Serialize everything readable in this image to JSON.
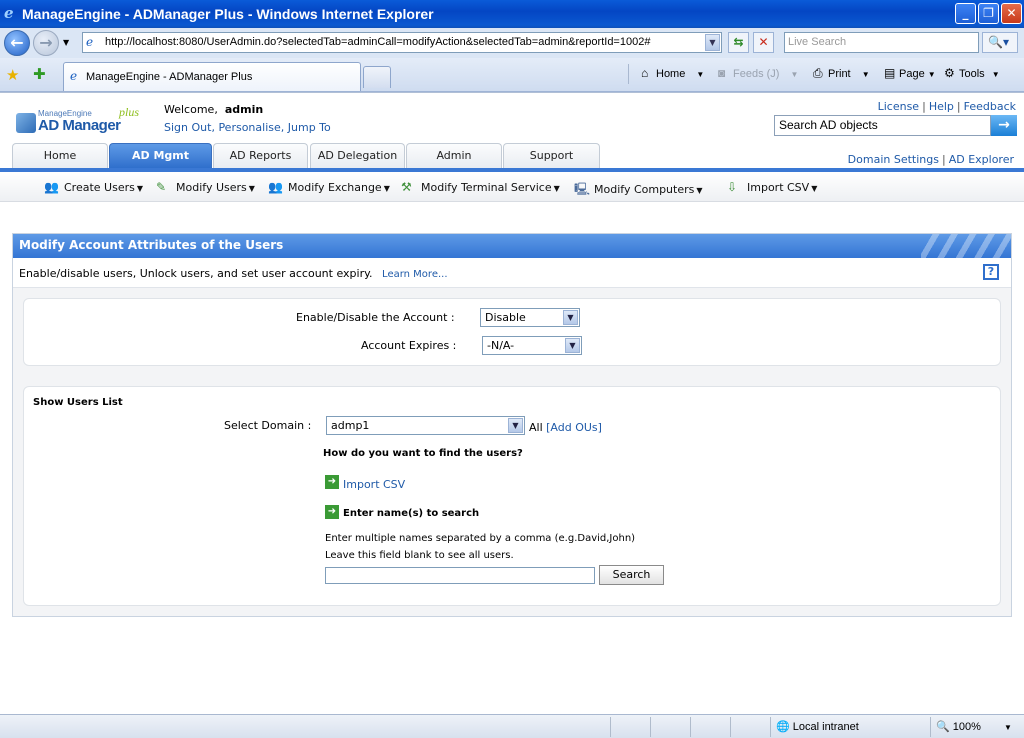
{
  "browser": {
    "window_title": "ManageEngine - ADManager Plus - Windows Internet Explorer",
    "url": "http://localhost:8080/UserAdmin.do?selectedTab=adminCall=modifyAction&selectedTab=admin&reportId=1002#",
    "search_placeholder": "Live Search",
    "tab_title": "ManageEngine - ADManager Plus",
    "commands": {
      "home": "Home",
      "feeds": "Feeds (J)",
      "print": "Print",
      "page": "Page",
      "tools": "Tools"
    },
    "status": {
      "zone": "Local intranet",
      "zoom": "100%"
    }
  },
  "app": {
    "logo": {
      "brand": "ManageEngine",
      "product": "AD Manager",
      "suffix": "plus"
    },
    "welcome_prefix": "Welcome,",
    "username": "admin",
    "user_links": [
      "Sign Out",
      "Personalise",
      "Jump To"
    ],
    "top_links": [
      "License",
      "Help",
      "Feedback"
    ],
    "search_placeholder": "Search AD objects",
    "tabs": [
      {
        "label": "Home",
        "active": false
      },
      {
        "label": "AD Mgmt",
        "active": true
      },
      {
        "label": "AD Reports",
        "active": false
      },
      {
        "label": "AD Delegation",
        "active": false
      },
      {
        "label": "Admin",
        "active": false
      },
      {
        "label": "Support",
        "active": false
      }
    ],
    "right_links": [
      "Domain Settings",
      "AD Explorer"
    ],
    "submenu": [
      "Create Users",
      "Modify Users",
      "Modify Exchange",
      "Modify Terminal Service",
      "Modify Computers",
      "Import CSV"
    ]
  },
  "panel": {
    "title": "Modify Account Attributes of the Users",
    "description": "Enable/disable users, Unlock users, and set user account expiry.",
    "learn_more": "Learn More...",
    "help": "?",
    "enable_label": "Enable/Disable the Account :",
    "enable_value": "Disable",
    "expires_label": "Account Expires :",
    "expires_value": "-N/A-",
    "show_users_title": "Show Users List",
    "domain_label": "Select Domain :",
    "domain_value": "admp1",
    "all_label": "All",
    "add_ous": "[Add OUs]",
    "how_question": "How do you want to find the users?",
    "import_csv": "Import CSV",
    "enter_names": "Enter name(s) to search",
    "hint1": "Enter multiple names separated by a comma (e.g.David,John)",
    "hint2": "Leave this field blank to see all users.",
    "search_button": "Search"
  }
}
